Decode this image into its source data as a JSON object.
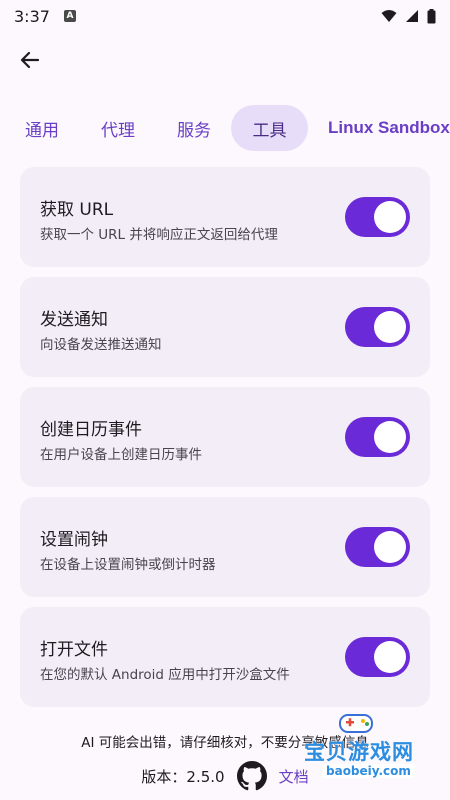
{
  "status": {
    "time": "3:37",
    "notification_badge": "A"
  },
  "tabs": [
    {
      "label": "通用"
    },
    {
      "label": "代理"
    },
    {
      "label": "服务"
    },
    {
      "label": "工具",
      "selected": true
    },
    {
      "label": "Linux Sandbox"
    }
  ],
  "tools": [
    {
      "title": "获取 URL",
      "description": "获取一个 URL 并将响应正文返回给代理",
      "enabled": true
    },
    {
      "title": "发送通知",
      "description": "向设备发送推送通知",
      "enabled": true
    },
    {
      "title": "创建日历事件",
      "description": "在用户设备上创建日历事件",
      "enabled": true
    },
    {
      "title": "设置闹钟",
      "description": "在设备上设置闹钟或倒计时器",
      "enabled": true
    },
    {
      "title": "打开文件",
      "description": "在您的默认 Android 应用中打开沙盒文件",
      "enabled": true
    }
  ],
  "footer": {
    "disclaimer": "AI 可能会出错，请仔细核对，不要分享敏感信息",
    "version": "版本：2.5.0",
    "docs_label": "文档"
  },
  "watermark": {
    "text": "宝贝游戏网",
    "url": "baobeiy.com"
  },
  "colors": {
    "accent": "#6a2ad8",
    "tab_selected_bg": "#e8ddf9",
    "card_bg": "#f3edf7"
  }
}
